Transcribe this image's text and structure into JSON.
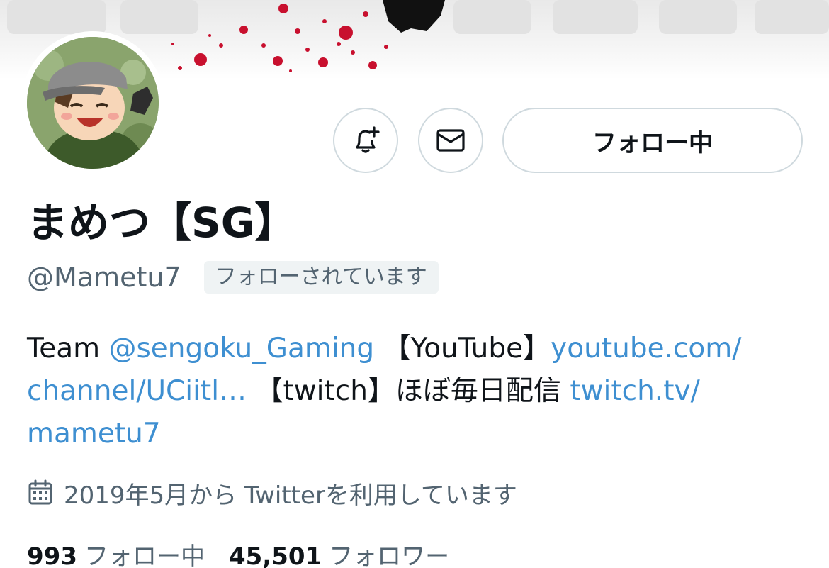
{
  "colors": {
    "text_primary": "#0f1419",
    "text_secondary": "#536471",
    "link": "#3e8fd1",
    "border": "#cfd9de",
    "badge_bg": "#eff3f4",
    "sakura": "#c8102e"
  },
  "icons": {
    "notify": "bell-plus-icon",
    "message": "envelope-icon",
    "calendar": "calendar-icon"
  },
  "actions": {
    "follow_label": "フォロー中"
  },
  "profile": {
    "display_name": "まめつ【SG】",
    "handle": "@Mametu7",
    "follows_you_badge": "フォローされています"
  },
  "bio": {
    "line1": {
      "t1": "Team ",
      "mention": "@sengoku_Gaming",
      "t2": " 【YouTube】",
      "link1": "youtube.com/"
    },
    "line2": {
      "link1_cont": "channel/UCiitl…",
      "t3": " 【twitch】ほぼ毎日配信 ",
      "link2": "twitch.tv/"
    },
    "line3": {
      "link2_cont": "mametu7"
    }
  },
  "joined": {
    "text": "2019年5月から Twitterを利用しています"
  },
  "stats": {
    "following_count": "993",
    "following_label": "フォロー中",
    "followers_count": "45,501",
    "followers_label": "フォロワー"
  }
}
